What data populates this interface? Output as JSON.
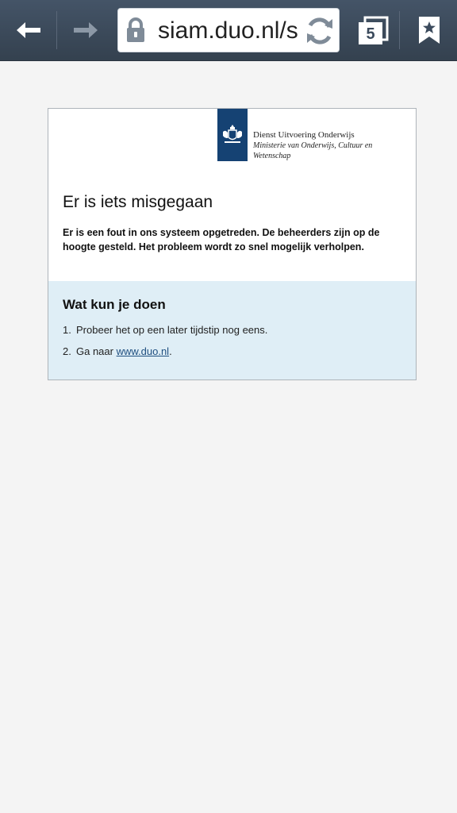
{
  "browser": {
    "url": "siam.duo.nl/s",
    "tab_count": "5",
    "icons": {
      "back": "back-arrow-icon",
      "forward": "forward-arrow-icon",
      "lock": "lock-icon",
      "reload": "reload-icon",
      "tabs": "tabs-icon",
      "bookmark": "bookmark-icon"
    }
  },
  "logo": {
    "line1": "Dienst Uitvoering Onderwijs",
    "line2": "Ministerie van Onderwijs, Cultuur en",
    "line3": "Wetenschap"
  },
  "error": {
    "title": "Er is iets misgegaan",
    "message": "Er is een fout in ons systeem opgetreden. De beheerders zijn op de hoogte gesteld. Het probleem wordt zo snel mogelijk verholpen."
  },
  "help": {
    "title": "Wat kun je doen",
    "items": [
      {
        "num": "1.",
        "text": "Probeer het op een later tijdstip nog eens."
      },
      {
        "num": "2.",
        "prefix": "Ga naar ",
        "link": "www.duo.nl",
        "suffix": "."
      }
    ]
  },
  "colors": {
    "toolbar": "#3b4a5c",
    "logo_blue": "#154273",
    "help_panel": "#dfeef6",
    "page_bg": "#f4f4f4"
  }
}
